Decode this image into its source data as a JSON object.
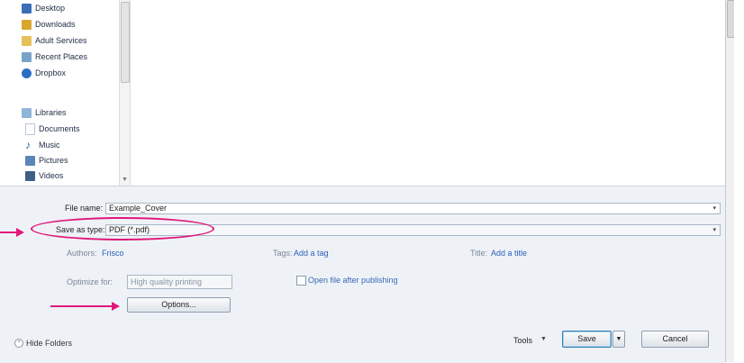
{
  "nav": {
    "favorites": [
      {
        "label": "Desktop",
        "icon": "desktop-icon",
        "color": "#3a6fb7"
      },
      {
        "label": "Downloads",
        "icon": "downloads-icon",
        "color": "#d9a62e"
      },
      {
        "label": "Adult Services",
        "icon": "folder-icon",
        "color": "#e6c15a"
      },
      {
        "label": "Recent Places",
        "icon": "recent-places-icon",
        "color": "#7aa3c9"
      },
      {
        "label": "Dropbox",
        "icon": "dropbox-icon",
        "color": "#2c6fc2"
      }
    ],
    "libraries_label": "Libraries",
    "libraries": [
      {
        "label": "Documents",
        "icon": "documents-icon",
        "color": "#b9c7d9"
      },
      {
        "label": "Music",
        "icon": "music-icon",
        "color": "#2d5fa8"
      },
      {
        "label": "Pictures",
        "icon": "pictures-icon",
        "color": "#5a86b8"
      },
      {
        "label": "Videos",
        "icon": "videos-icon",
        "color": "#3e5f86"
      }
    ]
  },
  "form": {
    "file_name_label": "File name:",
    "file_name_value": "Example_Cover",
    "save_as_type_label": "Save as type:",
    "save_as_type_value": "PDF (*.pdf)",
    "authors_label": "Authors:",
    "authors_value": "Frisco",
    "tags_label": "Tags:",
    "tags_value": "Add a tag",
    "title_label": "Title:",
    "title_value": "Add a title",
    "optimize_label": "Optimize for:",
    "optimize_value": "High quality printing",
    "open_after_label": "Open file after publishing",
    "options_button": "Options..."
  },
  "footer": {
    "hide_folders": "Hide Folders",
    "tools": "Tools",
    "save": "Save",
    "cancel": "Cancel"
  },
  "annotation_color": "#e0187a"
}
